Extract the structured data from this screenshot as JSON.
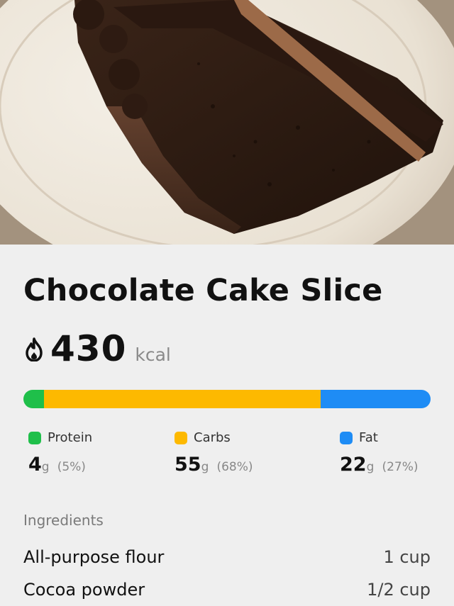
{
  "photo": {
    "subject": "chocolate-cake-slice-photo"
  },
  "food": {
    "name": "Chocolate Cake Slice",
    "calories": "430",
    "calorie_unit": "kcal"
  },
  "macro_bar": {
    "protein_fraction": 0.05,
    "carbs_fraction": 0.68,
    "fat_fraction": 0.27
  },
  "macros": [
    {
      "label": "Protein",
      "value": "4",
      "unit": "g",
      "percent": "(5%)",
      "color": "#1fbf4a"
    },
    {
      "label": "Carbs",
      "value": "55",
      "unit": "g",
      "percent": "(68%)",
      "color": "#fdb900"
    },
    {
      "label": "Fat",
      "value": "22",
      "unit": "g",
      "percent": "(27%)",
      "color": "#1e8cf5"
    }
  ],
  "ingredients": {
    "heading": "Ingredients",
    "items": [
      {
        "name": "All-purpose flour",
        "amount": "1 cup"
      },
      {
        "name": "Cocoa powder",
        "amount": "1/2 cup"
      }
    ]
  },
  "icons": {
    "calorie": "flame-icon"
  }
}
